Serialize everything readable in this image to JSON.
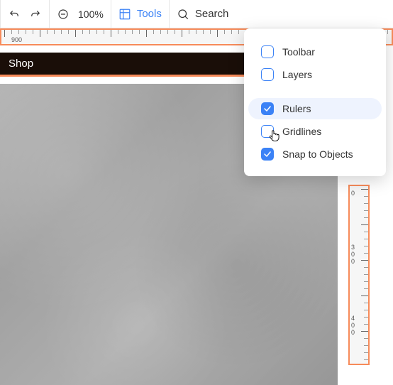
{
  "toolbar": {
    "undo_name": "undo",
    "redo_name": "redo",
    "zoom_out_name": "zoom-out",
    "zoom_level": "100%",
    "tools_label": "Tools",
    "search_label": "Search"
  },
  "ruler_h": {
    "number": "900"
  },
  "nav": {
    "shop_label": "Shop"
  },
  "menu": {
    "items": [
      {
        "label": "Toolbar",
        "checked": false,
        "highlight": false
      },
      {
        "label": "Layers",
        "checked": false,
        "highlight": false
      }
    ],
    "items2": [
      {
        "label": "Rulers",
        "checked": true,
        "highlight": true
      },
      {
        "label": "Gridlines",
        "checked": false,
        "highlight": false
      },
      {
        "label": "Snap to Objects",
        "checked": true,
        "highlight": false
      }
    ]
  },
  "ruler_v": {
    "marks": [
      "0",
      "3",
      "0",
      "0",
      "4",
      "0",
      "0"
    ]
  }
}
